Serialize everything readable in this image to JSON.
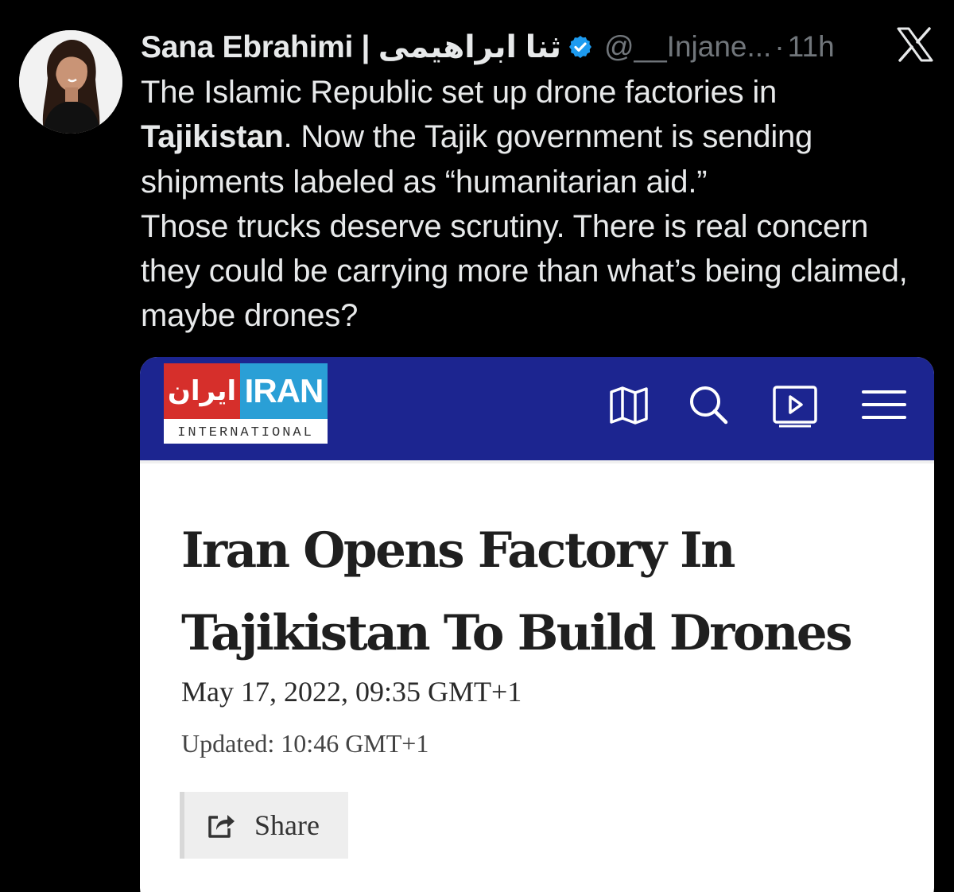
{
  "tweet": {
    "author": {
      "display_name": "Sana Ebrahimi | ثنا ابراهیمی",
      "handle": "@__Injane...",
      "verified": true,
      "avatar_icon": "profile-photo"
    },
    "separator": "·",
    "time": "11h",
    "platform_icon": "x-logo-icon",
    "text": {
      "seg1": "The Islamic Republic set up drone factories in",
      "seg2_bold": "Tajikistan",
      "seg3": ". Now the Tajik government is sending shipments labeled as “humanitarian aid.”",
      "seg4": "Those trucks deserve scrutiny. There is real concern they could be carrying more than what’s being claimed, maybe drones?"
    }
  },
  "card": {
    "brand": {
      "logo_fa": "ایران",
      "logo_en": "IRAN",
      "logo_sub": "INTERNATIONAL",
      "nav_color": "#1c2590",
      "red": "#d62f2b",
      "blue": "#2a9fd6"
    },
    "nav_icons": [
      "map-icon",
      "search-icon",
      "play-icon",
      "menu-icon"
    ],
    "headline": "Iran Opens Factory In Tajikistan To Build Drones",
    "date": "May 17, 2022, 09:35 GMT+1",
    "updated": "Updated: 10:46 GMT+1",
    "share_label": "Share"
  },
  "colors": {
    "background": "#000000",
    "text": "#e7e9ea",
    "muted": "#71767b",
    "verified": "#1d9bf0"
  }
}
